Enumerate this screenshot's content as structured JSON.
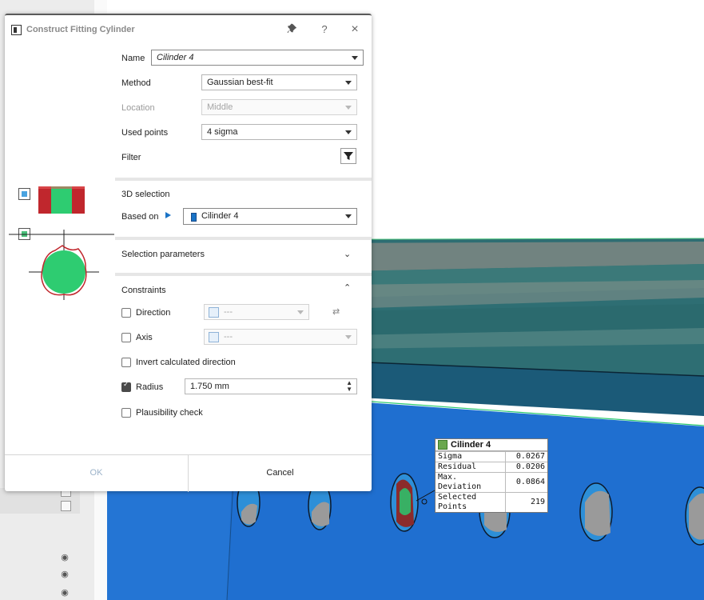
{
  "dialog": {
    "title": "Construct Fitting Cylinder",
    "pin_icon": "pin-icon",
    "help_label": "?",
    "close_label": "×",
    "name_label": "Name",
    "name_value": "Cilinder 4",
    "method_label": "Method",
    "method_value": "Gaussian best-fit",
    "location_label": "Location",
    "location_value": "Middle",
    "used_points_label": "Used points",
    "used_points_value": "4 sigma",
    "filter_label": "Filter",
    "selection_header": "3D selection",
    "based_on_label": "Based on",
    "based_on_value": "Cilinder 4",
    "selection_params_label": "Selection parameters",
    "constraints_label": "Constraints",
    "direction_label": "Direction",
    "direction_value": "---",
    "axis_label": "Axis",
    "axis_value": "---",
    "invert_label": "Invert calculated direction",
    "radius_label": "Radius",
    "radius_value": "1.750 mm",
    "radius_checked": true,
    "plausibility_label": "Plausibility check",
    "ok_label": "OK",
    "cancel_label": "Cancel"
  },
  "measurement": {
    "title": "Cilinder 4",
    "rows": [
      {
        "label": "Sigma",
        "value": "0.0267"
      },
      {
        "label": "Residual",
        "value": "0.0206"
      },
      {
        "label": "Max. Deviation",
        "value": "0.0864"
      },
      {
        "label": "Selected Points",
        "value": "219"
      }
    ]
  },
  "colors": {
    "accent": "#1a73c6",
    "surface_blue": "#1f6fd0",
    "top_teal": "#2b6a6e",
    "fit_green": "#2ecc71",
    "deviation_red": "#b02a2a"
  }
}
